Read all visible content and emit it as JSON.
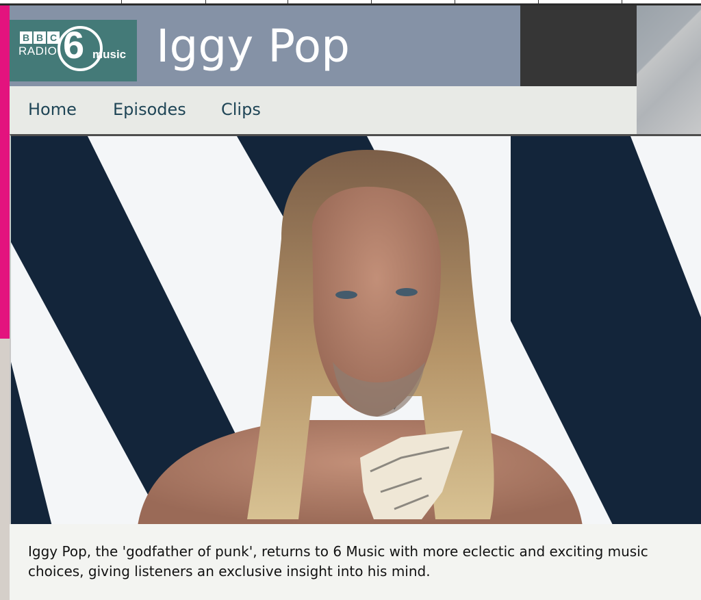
{
  "header": {
    "logo": {
      "bbc_letters": [
        "B",
        "B",
        "C"
      ],
      "radio": "RADIO",
      "six": "6",
      "music": "music"
    },
    "title": "Iggy Pop"
  },
  "nav": {
    "items": [
      {
        "label": "Home"
      },
      {
        "label": "Episodes"
      },
      {
        "label": "Clips"
      }
    ]
  },
  "hero": {
    "icon": "portrait-photo"
  },
  "description": "Iggy Pop, the 'godfather of punk', returns to 6 Music with more eclectic and exciting music choices, giving listeners an exclusive insight into his mind.",
  "colors": {
    "accent": "#e3137e",
    "header_bg": "#8592a6",
    "logo_bg": "#447a78",
    "nav_bg": "#e8eae6",
    "nav_text": "#1f4556"
  }
}
